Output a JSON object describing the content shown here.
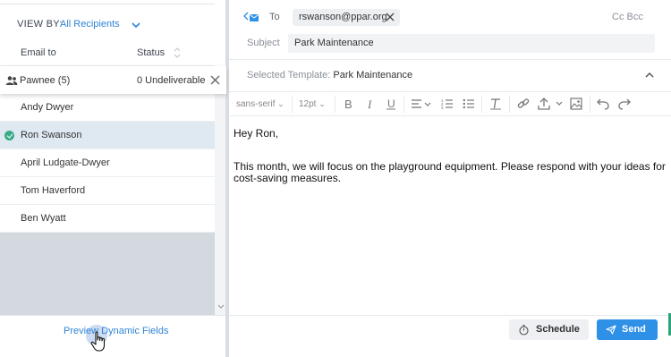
{
  "left_panel": {
    "view_by_label": "VIEW BY:",
    "view_by_value": "All Recipients",
    "columns": {
      "email": "Email to",
      "status": "Status"
    },
    "group": {
      "name": "Pawnee (5)",
      "status": "0 Undeliverable"
    },
    "recipients": [
      {
        "name": "Andy Dwyer",
        "selected": false
      },
      {
        "name": "Ron Swanson",
        "selected": true
      },
      {
        "name": "April Ludgate-Dwyer",
        "selected": false
      },
      {
        "name": "Tom Haverford",
        "selected": false
      },
      {
        "name": "Ben Wyatt",
        "selected": false
      }
    ],
    "preview_link": "Preview Dynamic Fields"
  },
  "composer": {
    "to_label": "To",
    "to_recipient": "rswanson@ppar.org",
    "cc_bcc": "Cc Bcc",
    "subject_label": "Subject",
    "subject_value": "Park Maintenance",
    "template_label": "Selected Template:",
    "template_value": "Park Maintenance",
    "toolbar": {
      "font": "sans-serif",
      "size": "12pt"
    },
    "body": {
      "greeting": "Hey Ron,",
      "paragraph": "This month, we will focus on the playground equipment. Please respond with your ideas for cost-saving measures."
    },
    "buttons": {
      "schedule": "Schedule",
      "send": "Send"
    }
  },
  "colors": {
    "accent": "#2e90e6",
    "link": "#2f84d6",
    "selected_row": "#dfe9f2",
    "check": "#3aaa87"
  }
}
